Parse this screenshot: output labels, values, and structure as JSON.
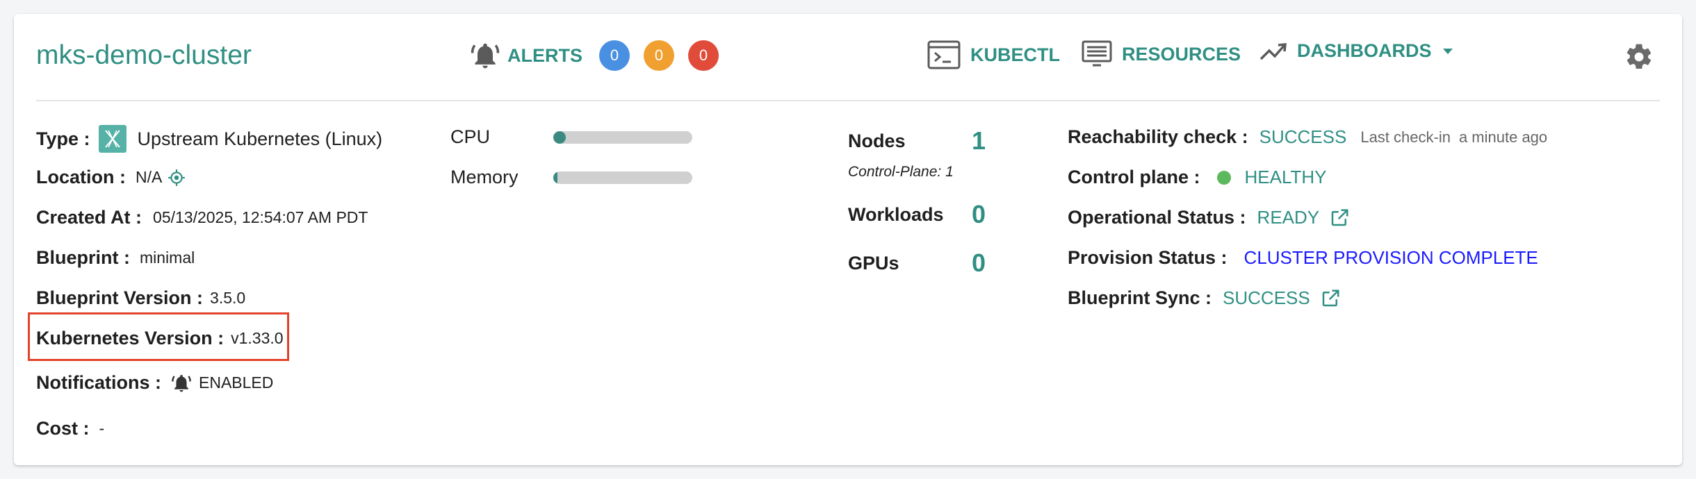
{
  "cluster": {
    "name": "mks-demo-cluster"
  },
  "header": {
    "alerts_label": "ALERTS",
    "alert_counts": [
      {
        "value": "0",
        "color": "#4a90e2"
      },
      {
        "value": "0",
        "color": "#f0a030"
      },
      {
        "value": "0",
        "color": "#e04b3a"
      }
    ],
    "kubectl_label": "KUBECTL",
    "resources_label": "RESOURCES",
    "dashboards_label": "DASHBOARDS"
  },
  "details": {
    "type_label": "Type :",
    "type_value": "Upstream Kubernetes (Linux)",
    "location_label": "Location :",
    "location_value": "N/A",
    "created_label": "Created At :",
    "created_value": "05/13/2025, 12:54:07 AM PDT",
    "blueprint_label": "Blueprint :",
    "blueprint_value": "minimal",
    "blueprint_version_label": "Blueprint Version :",
    "blueprint_version_value": "3.5.0",
    "k8s_version_label": "Kubernetes Version :",
    "k8s_version_value": "v1.33.0",
    "notifications_label": "Notifications :",
    "notifications_value": "ENABLED",
    "cost_label": "Cost :",
    "cost_value": "-"
  },
  "usage": {
    "cpu_label": "CPU",
    "cpu_fraction": 0.08,
    "memory_label": "Memory",
    "memory_fraction": 0.02
  },
  "stats": {
    "nodes_label": "Nodes",
    "nodes_value": "1",
    "control_plane_label": "Control-Plane: 1",
    "workloads_label": "Workloads",
    "workloads_value": "0",
    "gpus_label": "GPUs",
    "gpus_value": "0"
  },
  "health": {
    "reachability_label": "Reachability check :",
    "reachability_value": "SUCCESS",
    "last_checkin_label": "Last check-in",
    "last_checkin_value": "a minute ago",
    "control_plane_label": "Control plane :",
    "control_plane_value": "HEALTHY",
    "operational_label": "Operational Status :",
    "operational_value": "READY",
    "provision_label": "Provision Status :",
    "provision_value": "CLUSTER PROVISION COMPLETE",
    "blueprint_sync_label": "Blueprint Sync :",
    "blueprint_sync_value": "SUCCESS"
  },
  "colors": {
    "accent": "#2f8f83",
    "healthy_dot": "#5cb85c",
    "provision": "#1a1aff",
    "highlight": "#e2432a"
  }
}
